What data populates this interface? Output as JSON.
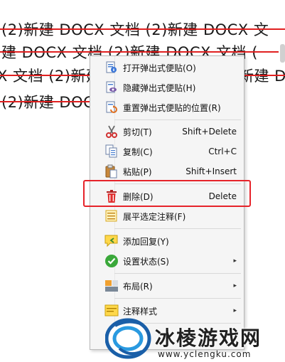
{
  "document": {
    "lines": [
      "(2)新建  DOCX  文档  (2)新建  DOCX  文",
      "建  DOCX  文档  (2)新建  DOCX  文档  (",
      "X  文档  (2)新建",
      "新建  D",
      "(2)新建  DOC"
    ]
  },
  "menu": {
    "items": [
      {
        "label": "打开弹出式便贴(O)",
        "shortcut": "",
        "icon": "sticky-note-open-icon"
      },
      {
        "label": "隐藏弹出式便贴(H)",
        "shortcut": "",
        "icon": "sticky-note-hide-icon"
      },
      {
        "label": "重置弹出式便贴的位置(R)",
        "shortcut": "",
        "icon": "sticky-note-reset-icon"
      },
      {
        "label": "剪切(T)",
        "shortcut": "Shift+Delete",
        "icon": "scissors-icon"
      },
      {
        "label": "复制(C)",
        "shortcut": "Ctrl+C",
        "icon": "copy-icon"
      },
      {
        "label": "粘贴(P)",
        "shortcut": "Shift+Insert",
        "icon": "paste-icon"
      },
      {
        "label": "删除(D)",
        "shortcut": "Delete",
        "icon": "trash-icon"
      },
      {
        "label": "展平选定注释(F)",
        "shortcut": "",
        "icon": "flatten-icon"
      },
      {
        "label": "添加回复(Y)",
        "shortcut": "",
        "icon": "reply-icon"
      },
      {
        "label": "设置状态(S)",
        "shortcut": "",
        "icon": "status-check-icon"
      },
      {
        "label": "布局(R)",
        "shortcut": "",
        "icon": "layout-icon"
      },
      {
        "label": "注释样式",
        "shortcut": "",
        "icon": "annotation-style-icon"
      }
    ],
    "submenu_arrow": "▸"
  },
  "watermark": {
    "name": "冰棱游戏网",
    "url": "www.yclengku.com"
  },
  "colors": {
    "strike": "#e02020",
    "highlight": "#e6232a"
  }
}
